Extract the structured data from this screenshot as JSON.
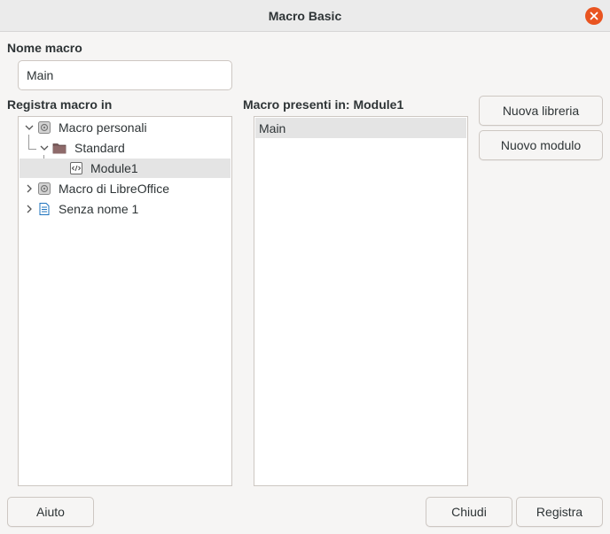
{
  "window": {
    "title": "Macro Basic",
    "close_icon": "close-icon"
  },
  "macro_name": {
    "label": "Nome macro",
    "value": "Main"
  },
  "save_in": {
    "label": "Registra macro in",
    "tree": [
      {
        "label": "Macro personali",
        "icon": "macro-library-icon",
        "expanded": true
      },
      {
        "label": "Standard",
        "icon": "folder-icon",
        "expanded": true
      },
      {
        "label": "Module1",
        "icon": "basic-module-icon",
        "selected": true
      },
      {
        "label": "Macro di LibreOffice",
        "icon": "macro-library-icon",
        "expanded": false
      },
      {
        "label": "Senza nome 1",
        "icon": "document-icon",
        "expanded": false
      }
    ]
  },
  "existing_macros": {
    "label": "Macro presenti in: Module1",
    "items": [
      "Main"
    ]
  },
  "side_buttons": {
    "new_library": "Nuova libreria",
    "new_module": "Nuovo modulo"
  },
  "footer": {
    "help": "Aiuto",
    "close": "Chiudi",
    "save": "Registra"
  },
  "colors": {
    "accent_close": "#e95420",
    "selection": "#e4e4e4",
    "background": "#f6f5f4"
  }
}
